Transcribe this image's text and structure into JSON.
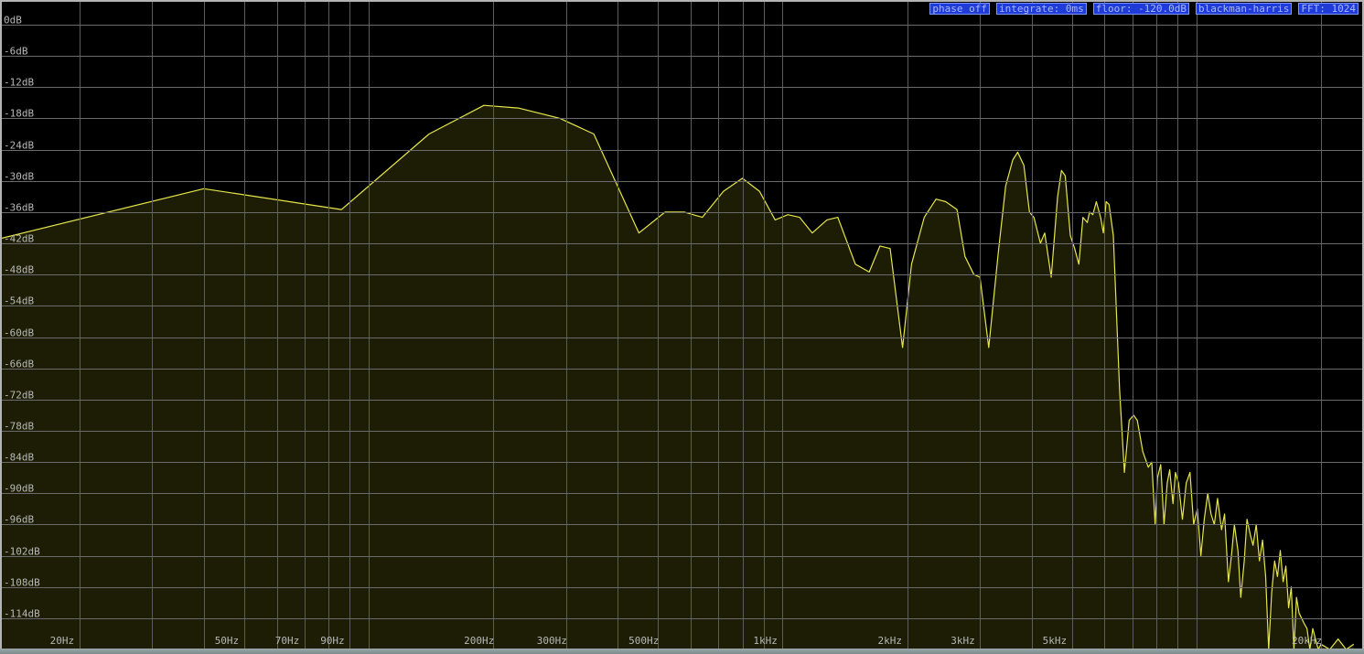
{
  "status": {
    "phase": "phase off",
    "integrate": "integrate: 0ms",
    "floor": "floor: -120.0dB",
    "window": "blackman-harris",
    "fft": "FFT: 1024"
  },
  "colors": {
    "background": "#000000",
    "trace": "#e6e64c",
    "fill": "#1f1f05",
    "grid": "#5c5c5c",
    "label": "#b8b8b8",
    "chip_bg": "#1f3bd8"
  },
  "chart_data": {
    "type": "area",
    "title": "",
    "xlabel": "",
    "ylabel": "",
    "xscale": "log",
    "xlim": [
      13,
      20000
    ],
    "ylim": [
      -120,
      0
    ],
    "grid": true,
    "y_ticks": [
      0,
      -6,
      -12,
      -18,
      -24,
      -30,
      -36,
      -42,
      -48,
      -54,
      -60,
      -66,
      -72,
      -78,
      -84,
      -90,
      -96,
      -102,
      -108,
      -114
    ],
    "y_tick_labels": [
      "0dB",
      "-6dB",
      "-12dB",
      "-18dB",
      "-24dB",
      "-30dB",
      "-36dB",
      "-42dB",
      "-48dB",
      "-54dB",
      "-60dB",
      "-66dB",
      "-72dB",
      "-78dB",
      "-84dB",
      "-90dB",
      "-96dB",
      "-102dB",
      "-108dB",
      "-114dB"
    ],
    "x_tick_labels": [
      {
        "f": 20,
        "label": "20Hz"
      },
      {
        "f": 50,
        "label": "50Hz"
      },
      {
        "f": 70,
        "label": "70Hz"
      },
      {
        "f": 90,
        "label": "90Hz"
      },
      {
        "f": 200,
        "label": "200Hz"
      },
      {
        "f": 300,
        "label": "300Hz"
      },
      {
        "f": 500,
        "label": "500Hz"
      },
      {
        "f": 1000,
        "label": "1kHz"
      },
      {
        "f": 2000,
        "label": "2kHz"
      },
      {
        "f": 3000,
        "label": "3kHz"
      },
      {
        "f": 5000,
        "label": "5kHz"
      },
      {
        "f": 20000,
        "label": "20kHz"
      }
    ],
    "x_grid": [
      20,
      30,
      40,
      50,
      60,
      70,
      80,
      90,
      100,
      200,
      300,
      400,
      500,
      600,
      700,
      800,
      900,
      1000,
      2000,
      3000,
      4000,
      5000,
      6000,
      7000,
      8000,
      9000,
      10000,
      20000
    ],
    "series": [
      {
        "points": [
          [
            13,
            -41
          ],
          [
            40,
            -31.5
          ],
          [
            86,
            -35.5
          ],
          [
            140,
            -21
          ],
          [
            190,
            -15.5
          ],
          [
            230,
            -16
          ],
          [
            290,
            -18
          ],
          [
            350,
            -21
          ],
          [
            450,
            -40
          ],
          [
            520,
            -36
          ],
          [
            580,
            -36
          ],
          [
            640,
            -37
          ],
          [
            720,
            -32
          ],
          [
            800,
            -29.5
          ],
          [
            880,
            -32
          ],
          [
            960,
            -37.5
          ],
          [
            1030,
            -36.5
          ],
          [
            1100,
            -37
          ],
          [
            1180,
            -40
          ],
          [
            1280,
            -37.5
          ],
          [
            1360,
            -37
          ],
          [
            1500,
            -46
          ],
          [
            1620,
            -47.5
          ],
          [
            1720,
            -42.5
          ],
          [
            1820,
            -43
          ],
          [
            1950,
            -62
          ],
          [
            2050,
            -46
          ],
          [
            2200,
            -37
          ],
          [
            2350,
            -33.5
          ],
          [
            2480,
            -34
          ],
          [
            2640,
            -35.5
          ],
          [
            2760,
            -44.5
          ],
          [
            2900,
            -48
          ],
          [
            3000,
            -48.5
          ],
          [
            3150,
            -62
          ],
          [
            3320,
            -44
          ],
          [
            3460,
            -31
          ],
          [
            3600,
            -26
          ],
          [
            3700,
            -24.5
          ],
          [
            3830,
            -27
          ],
          [
            3950,
            -36
          ],
          [
            4050,
            -37
          ],
          [
            4200,
            -42
          ],
          [
            4300,
            -40
          ],
          [
            4460,
            -48.5
          ],
          [
            4620,
            -33
          ],
          [
            4720,
            -28
          ],
          [
            4820,
            -29
          ],
          [
            4960,
            -40.5
          ],
          [
            5080,
            -43
          ],
          [
            5200,
            -46
          ],
          [
            5320,
            -37
          ],
          [
            5450,
            -38
          ],
          [
            5520,
            -36
          ],
          [
            5620,
            -36.5
          ],
          [
            5730,
            -34
          ],
          [
            5870,
            -37
          ],
          [
            5960,
            -40
          ],
          [
            6050,
            -34
          ],
          [
            6150,
            -34.5
          ],
          [
            6300,
            -40.5
          ],
          [
            6520,
            -70
          ],
          [
            6700,
            -86
          ],
          [
            6880,
            -76
          ],
          [
            7050,
            -75
          ],
          [
            7200,
            -76
          ],
          [
            7420,
            -82
          ],
          [
            7650,
            -85
          ],
          [
            7800,
            -84
          ],
          [
            7950,
            -96
          ],
          [
            8050,
            -87
          ],
          [
            8200,
            -84.5
          ],
          [
            8350,
            -96
          ],
          [
            8500,
            -88
          ],
          [
            8620,
            -85.5
          ],
          [
            8780,
            -92
          ],
          [
            8900,
            -86
          ],
          [
            9050,
            -88
          ],
          [
            9250,
            -95
          ],
          [
            9450,
            -88
          ],
          [
            9650,
            -86
          ],
          [
            9850,
            -96
          ],
          [
            10050,
            -93
          ],
          [
            10250,
            -102
          ],
          [
            10450,
            -95
          ],
          [
            10650,
            -90
          ],
          [
            10850,
            -94
          ],
          [
            11050,
            -96
          ],
          [
            11250,
            -91
          ],
          [
            11500,
            -97
          ],
          [
            11700,
            -94
          ],
          [
            11950,
            -107
          ],
          [
            12150,
            -102
          ],
          [
            12350,
            -96
          ],
          [
            12600,
            -101
          ],
          [
            12800,
            -110
          ],
          [
            13050,
            -103
          ],
          [
            13250,
            -95
          ],
          [
            13500,
            -98
          ],
          [
            13700,
            -100
          ],
          [
            13950,
            -96
          ],
          [
            14200,
            -103
          ],
          [
            14450,
            -99
          ],
          [
            14700,
            -106
          ],
          [
            14950,
            -120
          ],
          [
            15200,
            -109
          ],
          [
            15450,
            -103
          ],
          [
            15700,
            -106
          ],
          [
            15950,
            -101
          ],
          [
            16200,
            -107
          ],
          [
            16450,
            -104
          ],
          [
            16700,
            -112
          ],
          [
            16950,
            -108
          ],
          [
            17200,
            -120
          ],
          [
            17450,
            -110
          ],
          [
            17700,
            -113
          ],
          [
            17950,
            -114
          ],
          [
            18200,
            -115
          ],
          [
            18500,
            -116
          ],
          [
            18800,
            -120
          ],
          [
            19100,
            -116
          ],
          [
            19400,
            -118
          ],
          [
            19700,
            -120
          ],
          [
            20000,
            -119
          ],
          [
            21000,
            -120
          ],
          [
            22000,
            -118
          ],
          [
            23000,
            -120
          ],
          [
            24000,
            -119
          ]
        ]
      }
    ]
  }
}
